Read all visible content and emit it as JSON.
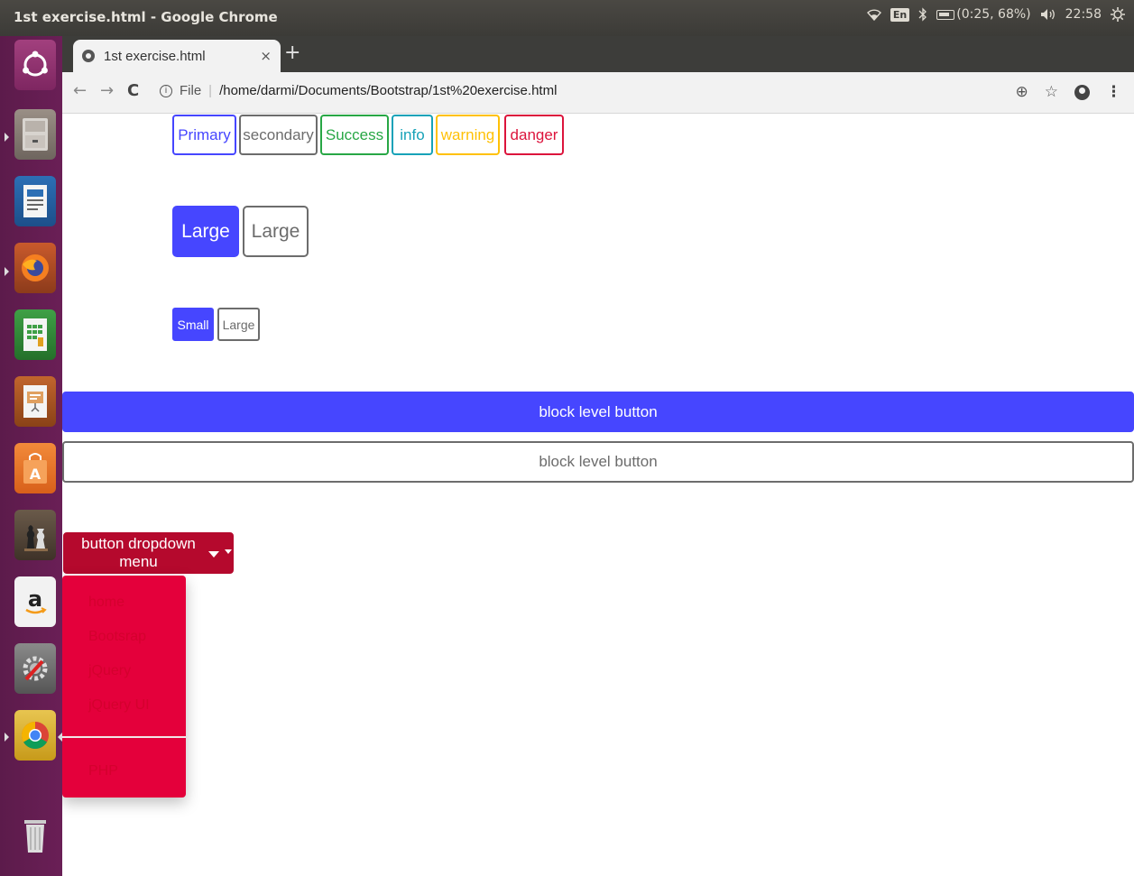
{
  "os_panel": {
    "window_title": "1st exercise.html - Google Chrome",
    "keyboard_layout": "En",
    "battery_status": "(0:25, 68%)",
    "clock": "22:58",
    "wifi_icon": "wifi-icon",
    "bluetooth_icon": "bluetooth-icon",
    "volume_icon": "volume-icon",
    "power_icon": "gear-icon"
  },
  "launcher": {
    "items": [
      "ubuntu-dash",
      "files",
      "libreoffice-writer",
      "firefox",
      "libreoffice-calc",
      "libreoffice-impress",
      "ubuntu-software",
      "chess",
      "amazon",
      "system-settings",
      "chrome",
      "trash"
    ]
  },
  "browser": {
    "tab_title": "1st exercise.html",
    "tab_close": "×",
    "new_tab": "+",
    "back": "←",
    "forward": "→",
    "reload": "C",
    "url_scheme_label": "File",
    "url_path": "/home/darmi/Documents/Bootstrap/1st%20exercise.html",
    "zoom_icon": "⊕",
    "star_icon": "☆",
    "menu_icon": "⋮"
  },
  "page": {
    "outline_buttons": {
      "primary": "Primary",
      "secondary": "secondary",
      "success": "Success",
      "info": "info",
      "warning": "warning",
      "danger": "danger"
    },
    "large_buttons": {
      "solid": "Large",
      "outline": "Large"
    },
    "small_buttons": {
      "solid": "Small",
      "outline": "Large"
    },
    "block_buttons": {
      "solid": "block level button",
      "outline": "block level button"
    },
    "dropdown": {
      "label": "button dropdown menu",
      "items": [
        "home",
        "Bootsrap",
        "jQuery",
        "jQuery UI"
      ],
      "after_divider": "PHP"
    }
  },
  "colors": {
    "primary": "#4646ff",
    "secondary": "#6c6c6c",
    "success": "#28a745",
    "info": "#17a2b8",
    "warning": "#ffc107",
    "danger": "#dc143c",
    "dropdown_button": "#b5092d",
    "dropdown_menu": "#e4003b"
  }
}
